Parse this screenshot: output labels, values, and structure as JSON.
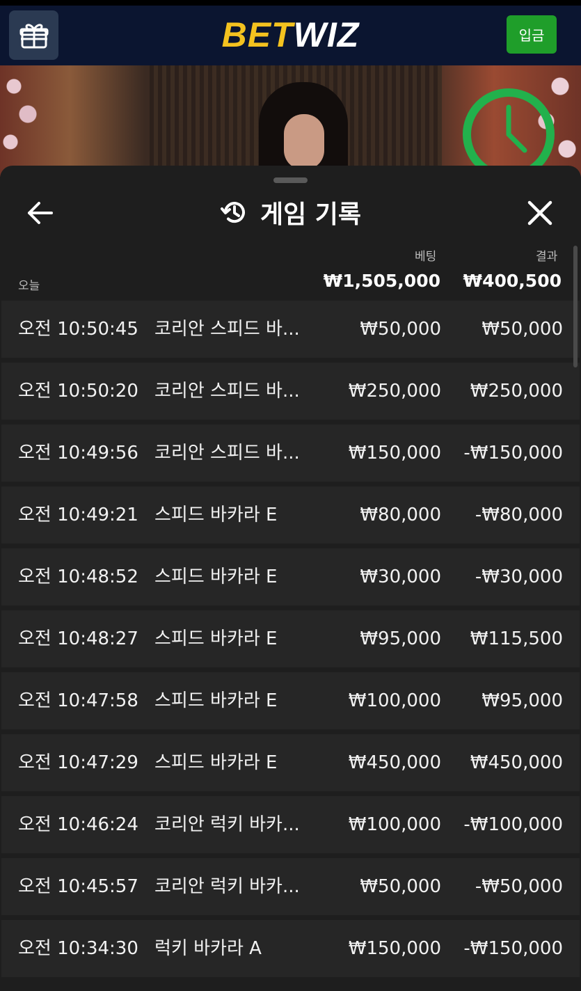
{
  "topbar": {
    "logo_part1": "BET",
    "logo_part2": "WIZ",
    "deposit_label": "입금"
  },
  "sheet": {
    "title": "게임 기록",
    "section_label": "오늘",
    "bet_header": "베팅",
    "result_header": "결과",
    "bet_total": "₩1,505,000",
    "result_total": "₩400,500",
    "rows": [
      {
        "time": "오전 10:50:45",
        "game": "코리안 스피드 바...",
        "bet": "₩50,000",
        "result": "₩50,000"
      },
      {
        "time": "오전 10:50:20",
        "game": "코리안 스피드 바...",
        "bet": "₩250,000",
        "result": "₩250,000"
      },
      {
        "time": "오전 10:49:56",
        "game": "코리안 스피드 바...",
        "bet": "₩150,000",
        "result": "-₩150,000"
      },
      {
        "time": "오전 10:49:21",
        "game": "스피드 바카라 E",
        "bet": "₩80,000",
        "result": "-₩80,000"
      },
      {
        "time": "오전 10:48:52",
        "game": "스피드 바카라 E",
        "bet": "₩30,000",
        "result": "-₩30,000"
      },
      {
        "time": "오전 10:48:27",
        "game": "스피드 바카라 E",
        "bet": "₩95,000",
        "result": "₩115,500"
      },
      {
        "time": "오전 10:47:58",
        "game": "스피드 바카라 E",
        "bet": "₩100,000",
        "result": "₩95,000"
      },
      {
        "time": "오전 10:47:29",
        "game": "스피드 바카라 E",
        "bet": "₩450,000",
        "result": "₩450,000"
      },
      {
        "time": "오전 10:46:24",
        "game": "코리안 럭키 바카...",
        "bet": "₩100,000",
        "result": "-₩100,000"
      },
      {
        "time": "오전 10:45:57",
        "game": "코리안 럭키 바카...",
        "bet": "₩50,000",
        "result": "-₩50,000"
      },
      {
        "time": "오전 10:34:30",
        "game": "럭키 바카라 A",
        "bet": "₩150,000",
        "result": "-₩150,000"
      }
    ]
  },
  "colors": {
    "topbar_bg": "#0b1530",
    "logo_yellow": "#f4c21f",
    "deposit_green": "#1f9e2a",
    "timer_green": "#22b14c",
    "sheet_bg": "#1e1e1e",
    "row_bg": "#262626"
  },
  "icons": [
    "gift-icon",
    "back-arrow-icon",
    "history-icon",
    "close-icon",
    "timer-icon"
  ]
}
